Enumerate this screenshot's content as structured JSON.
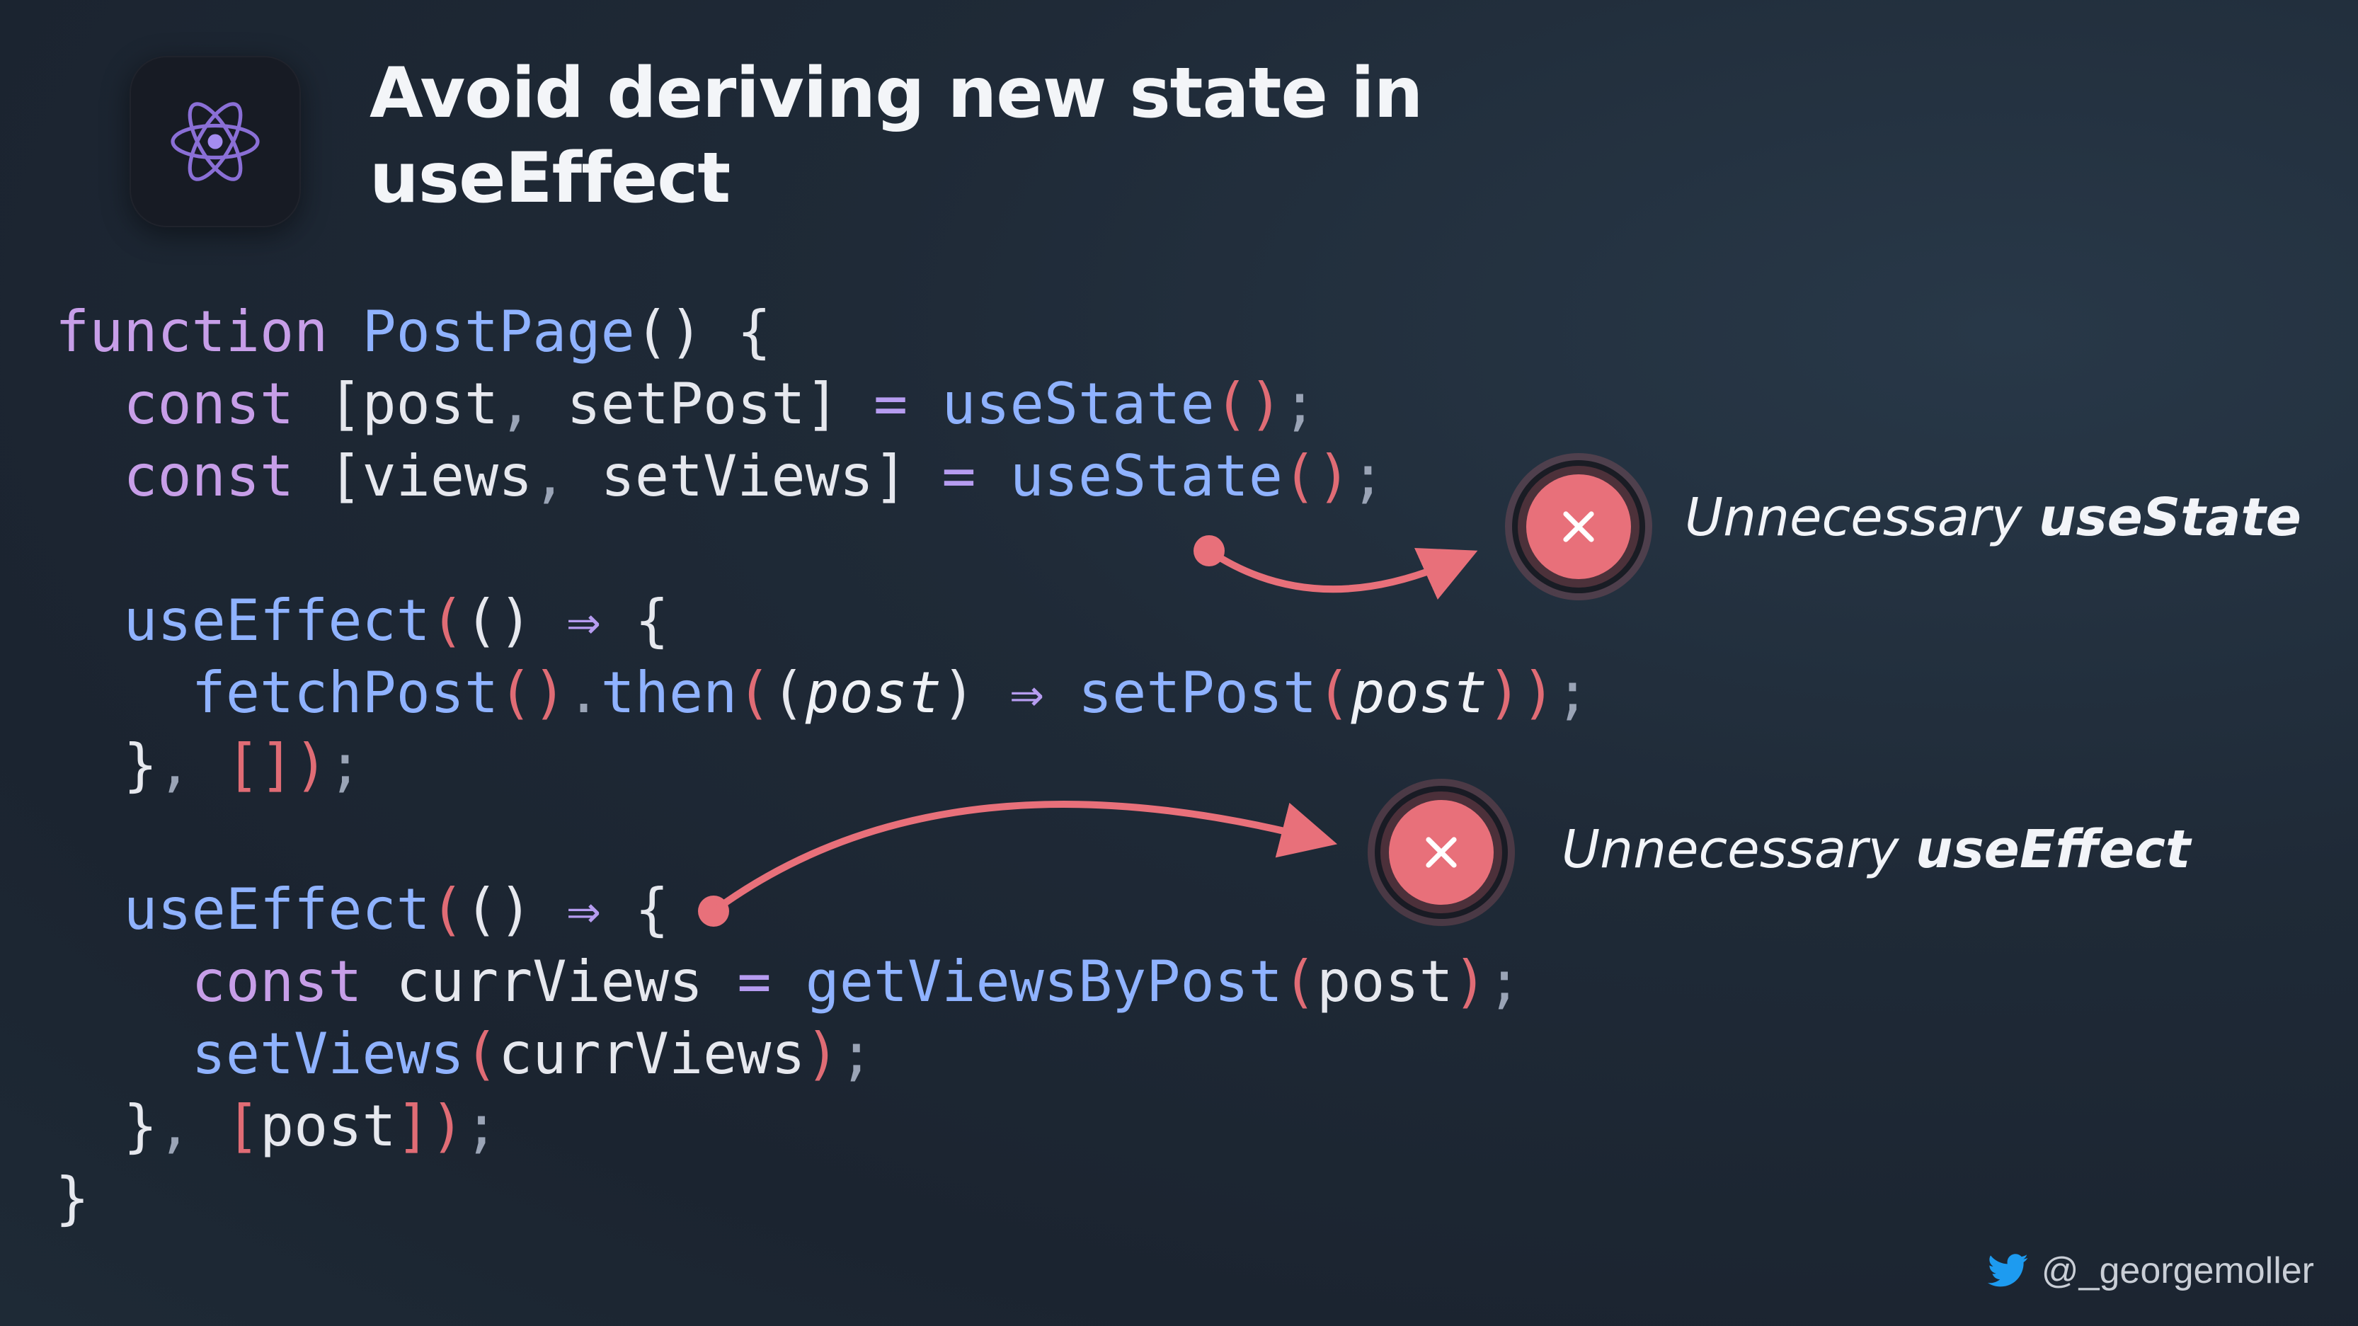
{
  "title": {
    "line1": "Avoid deriving new state in",
    "line2": "useEffect"
  },
  "logo_icon": "react-atom-icon",
  "code": {
    "l1": {
      "kw": "function",
      "fn": "PostPage",
      "paren": "()",
      "brace": "{"
    },
    "l2": {
      "kw": "const",
      "open": "[",
      "a": "post",
      "comma": ",",
      "b": "setPost",
      "close": "]",
      "eq": "=",
      "fn": "useState",
      "paren": "()",
      "semi": ";"
    },
    "l3": {
      "kw": "const",
      "open": "[",
      "a": "views",
      "comma": ",",
      "b": "setViews",
      "close": "]",
      "eq": "=",
      "fn": "useState",
      "paren": "()",
      "semi": ";"
    },
    "l5": {
      "fn": "useEffect",
      "po": "(",
      "args": "()",
      "arrow": "⇒",
      "brace": "{"
    },
    "l6": {
      "fn": "fetchPost",
      "paren": "()",
      "dot": ".",
      "then": "then",
      "po": "(",
      "apo": "(",
      "param": "post",
      "apc": ")",
      "arrow": "⇒",
      "fn2": "setPost",
      "p2o": "(",
      "arg": "post",
      "p2c": ")",
      "pc": ")",
      "semi": ";"
    },
    "l7": {
      "close": "}",
      "comma": ",",
      "dep_o": "[",
      "dep_c": "]",
      "pc": ")",
      "semi": ";"
    },
    "l9": {
      "fn": "useEffect",
      "po": "(",
      "args": "()",
      "arrow": "⇒",
      "brace": "{"
    },
    "l10": {
      "kw": "const",
      "var": "currViews",
      "eq": "=",
      "fn": "getViewsByPost",
      "po": "(",
      "arg": "post",
      "pc": ")",
      "semi": ";"
    },
    "l11": {
      "fn": "setViews",
      "po": "(",
      "arg": "currViews",
      "pc": ")",
      "semi": ";"
    },
    "l12": {
      "close": "}",
      "comma": ",",
      "dep_o": "[",
      "dep": "post",
      "dep_c": "]",
      "pc": ")",
      "semi": ";"
    },
    "l13": {
      "close": "}"
    }
  },
  "annotations": [
    {
      "prefix": "Unnecessary",
      "emph": "useState",
      "icon": "close-icon"
    },
    {
      "prefix": "Unnecessary",
      "emph": "useEffect",
      "icon": "close-icon"
    }
  ],
  "footer": {
    "handle": "@_georgemoller",
    "icon": "twitter-bird-icon"
  },
  "colors": {
    "accent": "#e8707a",
    "keyword": "#c79ee8",
    "function": "#8fb2ff",
    "bracket": "#e06c75"
  }
}
